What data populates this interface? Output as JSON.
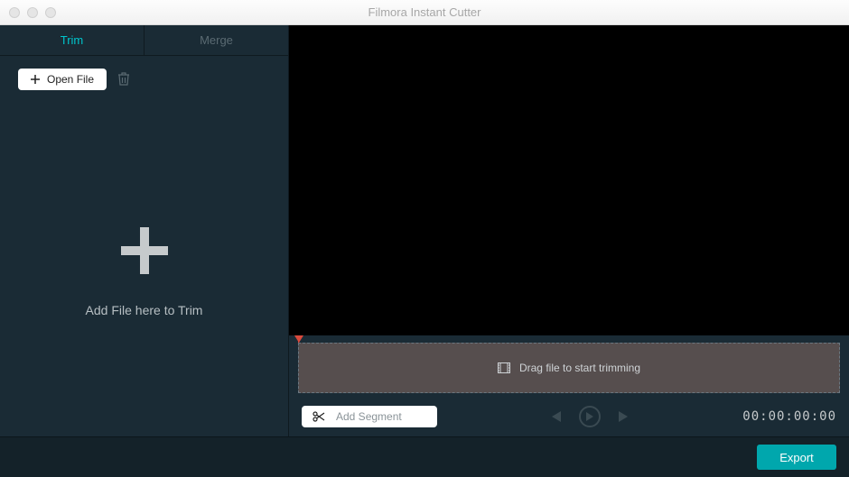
{
  "window": {
    "title": "Filmora Instant Cutter"
  },
  "tabs": {
    "trim": "Trim",
    "merge": "Merge"
  },
  "sidebar": {
    "open_file_label": "Open File",
    "dropzone_label": "Add File here to Trim"
  },
  "timeline": {
    "placeholder": "Drag file to start trimming"
  },
  "controls": {
    "add_segment_label": "Add Segment",
    "timecode": "00:00:00:00"
  },
  "footer": {
    "export_label": "Export"
  }
}
